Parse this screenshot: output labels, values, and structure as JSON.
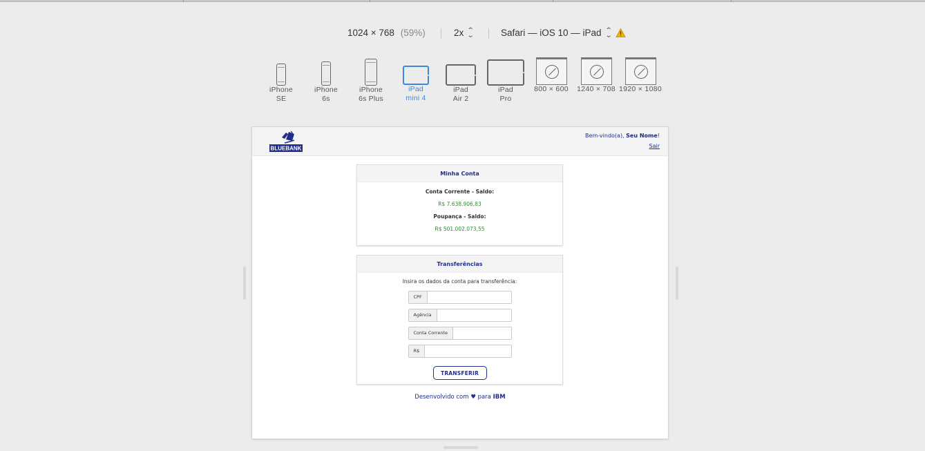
{
  "toolbar": {
    "dimensions": "1024 × 768",
    "zoom_percent": "(59%)",
    "scale": "2x",
    "environment": "Safari — iOS 10 — iPad"
  },
  "devices": [
    {
      "line1": "iPhone",
      "line2": "SE"
    },
    {
      "line1": "iPhone",
      "line2": "6s"
    },
    {
      "line1": "iPhone",
      "line2": "6s Plus"
    },
    {
      "line1": "iPad",
      "line2": "mini 4",
      "selected": true
    },
    {
      "line1": "iPad",
      "line2": "Air 2"
    },
    {
      "line1": "iPad",
      "line2": "Pro"
    }
  ],
  "resolutions": [
    "800 × 600",
    "1240 × 708",
    "1920 × 1080"
  ],
  "site": {
    "logo_text": "BLUEBANK",
    "welcome_prefix": "Bem-vindo(a),",
    "user_name": "Seu Nome",
    "welcome_suffix": "!",
    "logout_label": "Sair"
  },
  "account": {
    "title": "Minha Conta",
    "checking_label": "Conta Corrente - Saldo:",
    "checking_balance": "R$ 7.638.906,83",
    "savings_label": "Poupança - Saldo:",
    "savings_balance": "R$ 501.002.073,55"
  },
  "transfer": {
    "title": "Transferências",
    "intro": "Insira os dados da conta para transferência:",
    "fields": [
      {
        "label": "CPF",
        "value": ""
      },
      {
        "label": "Agência",
        "value": ""
      },
      {
        "label": "Conta Corrente",
        "value": ""
      },
      {
        "label": "R$",
        "value": ""
      }
    ],
    "submit_label": "TRANSFERIR"
  },
  "footer": {
    "prefix": "Desenvolvido com",
    "heart": "♥",
    "middle": "para",
    "brand": "IBM"
  },
  "colors": {
    "accent": "#3b87e0",
    "brand_navy": "#1f2e8a",
    "money_green": "#2e8b2e",
    "warning": "#f0b400"
  }
}
